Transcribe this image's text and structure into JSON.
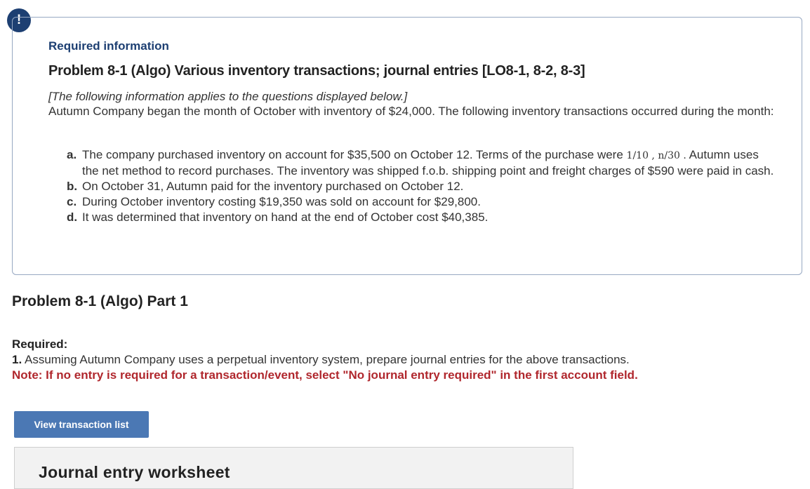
{
  "alert": {
    "glyph": "!"
  },
  "info": {
    "heading": "Required information",
    "problem_title": "Problem 8-1 (Algo) Various inventory transactions; journal entries [LO8-1, 8-2, 8-3]",
    "applies_note": "[The following information applies to the questions displayed below.]",
    "intro": "Autumn Company began the month of October with inventory of $24,000. The following inventory transactions occurred during the month:",
    "items": [
      {
        "letter": "a.",
        "text_before": "The company purchased inventory on account for $35,500 on October 12. Terms of the purchase were",
        "terms": "1/10 , n/30 .",
        "text_after": "Autumn uses the net method to record purchases. The inventory was shipped f.o.b. shipping point and freight charges of $590 were paid in cash."
      },
      {
        "letter": "b.",
        "text": "On October 31, Autumn paid for the inventory purchased on October 12."
      },
      {
        "letter": "c.",
        "text": "During October inventory costing $19,350 was sold on account for $29,800."
      },
      {
        "letter": "d.",
        "text": "It was determined that inventory on hand at the end of October cost $40,385."
      }
    ]
  },
  "part": {
    "title": "Problem 8-1 (Algo) Part 1",
    "required_label": "Required:",
    "required_number": "1.",
    "required_text": "Assuming Autumn Company uses a perpetual inventory system, prepare journal entries for the above transactions.",
    "note": "Note: If no entry is required for a transaction/event, select \"No journal entry required\" in the first account field."
  },
  "buttons": {
    "view_transactions": "View transaction list"
  },
  "worksheet": {
    "title": "Journal entry worksheet"
  },
  "colors": {
    "brand_navy": "#1d3f72",
    "note_red": "#b0272d",
    "button_blue": "#4b78b4"
  }
}
